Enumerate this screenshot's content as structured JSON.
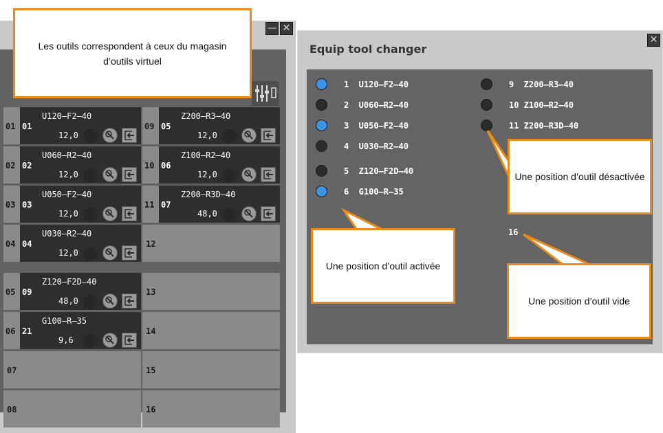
{
  "top_note": "Les outils correspondent à ceux du magasin d’outils virtuel",
  "magazine": {
    "left_slots": [
      {
        "num": "01",
        "tool_id": "01",
        "name": "U120–F2–40",
        "value": "12,0"
      },
      {
        "num": "02",
        "tool_id": "02",
        "name": "U060–R2–40",
        "value": "12,0"
      },
      {
        "num": "03",
        "tool_id": "03",
        "name": "U050–F2–40",
        "value": "12,0"
      },
      {
        "num": "04",
        "tool_id": "04",
        "name": "U030–R2–40",
        "value": "12,0"
      },
      {
        "num": "05",
        "tool_id": "09",
        "name": "Z120–F2D–40",
        "value": "48,0"
      },
      {
        "num": "06",
        "tool_id": "21",
        "name": "G100–R–35",
        "value": "9,6"
      },
      {
        "num": "07"
      },
      {
        "num": "08"
      }
    ],
    "right_slots": [
      {
        "num": "09",
        "tool_id": "05",
        "name": "Z200–R3–40",
        "value": "12,0"
      },
      {
        "num": "10",
        "tool_id": "06",
        "name": "Z100–R2–40",
        "value": "12,0"
      },
      {
        "num": "11",
        "tool_id": "07",
        "name": "Z200–R3D–40",
        "value": "48,0"
      },
      {
        "num": "12"
      },
      {
        "num": "13"
      },
      {
        "num": "14"
      },
      {
        "num": "15"
      },
      {
        "num": "16"
      }
    ],
    "minimize_glyph": "—",
    "close_glyph": "✕",
    "icon_names": [
      "tool-edit-icon",
      "tool-eject-icon",
      "settings-sliders-icon"
    ]
  },
  "changer": {
    "title": "Equip tool changer",
    "close_glyph": "✕",
    "positions": [
      {
        "label": "1  U120–F2–40",
        "active": true
      },
      {
        "label": "2  U060–R2–40",
        "active": false
      },
      {
        "label": "3  U050–F2–40",
        "active": true
      },
      {
        "label": "4  U030–R2–40",
        "active": false
      },
      {
        "label": "5  Z120–F2D–40",
        "active": false
      },
      {
        "label": "6  G100–R–35",
        "active": true
      },
      {
        "label": "9  Z200–R3–40",
        "active": false
      },
      {
        "label": "10 Z100–R2–40",
        "active": false
      },
      {
        "label": "11 Z200–R3D–40",
        "active": false
      }
    ],
    "empty_label": "16",
    "active_color": "#3b93e6",
    "inactive_color": "#2b2b2b"
  },
  "callouts": {
    "deactivated": "Une position d’outil désactivée",
    "activated": "Une position d’outil activée",
    "empty": "Une position d’outil vide"
  },
  "accent_color": "#e88b1a"
}
